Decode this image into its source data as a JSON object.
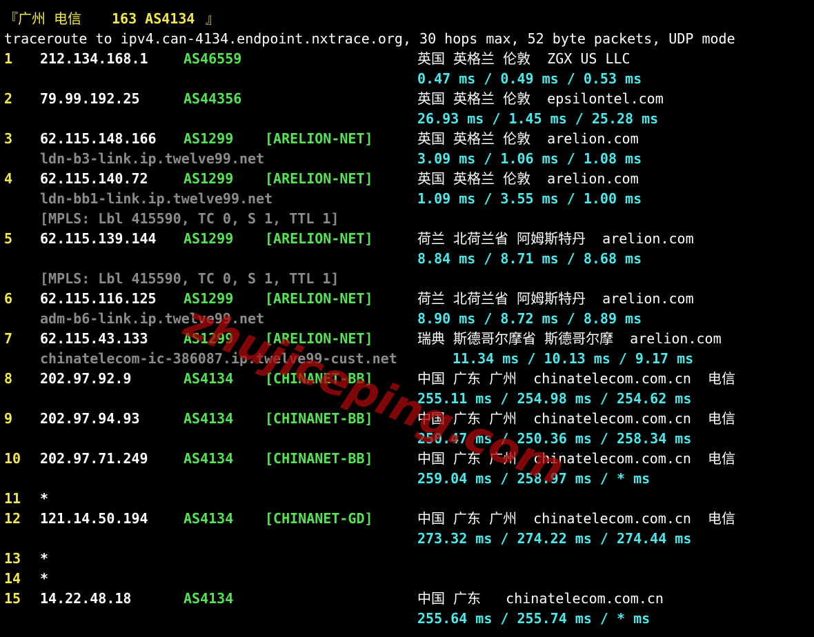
{
  "header": {
    "title_open": "『广州 电信 ",
    "title_bold": "163 AS4134",
    "title_close": " 』",
    "traceroute_line": "traceroute to ipv4.can-4134.endpoint.nxtrace.org, 30 hops max, 52 byte packets, UDP mode"
  },
  "hops": [
    {
      "num": "1",
      "ip": "212.134.168.1",
      "asn": "AS46559",
      "net": "",
      "geo": "英国 英格兰 伦敦  ZGX US LLC",
      "rtt": "0.47 ms / 0.49 ms / 0.53 ms",
      "host": "",
      "mpls": ""
    },
    {
      "num": "2",
      "ip": "79.99.192.25",
      "asn": "AS44356",
      "net": "",
      "geo": "英国 英格兰 伦敦  epsilontel.com",
      "rtt": "26.93 ms / 1.45 ms / 25.28 ms",
      "host": "",
      "mpls": ""
    },
    {
      "num": "3",
      "ip": "62.115.148.166",
      "asn": "AS1299",
      "net": "[ARELION-NET]",
      "geo": "英国 英格兰 伦敦  arelion.com",
      "rtt": "3.09 ms / 1.06 ms / 1.08 ms",
      "host": "ldn-b3-link.ip.twelve99.net",
      "mpls": ""
    },
    {
      "num": "4",
      "ip": "62.115.140.72",
      "asn": "AS1299",
      "net": "[ARELION-NET]",
      "geo": "英国 英格兰 伦敦  arelion.com",
      "rtt": "1.09 ms / 3.55 ms / 1.00 ms",
      "host": "ldn-bb1-link.ip.twelve99.net",
      "mpls": "[MPLS: Lbl 415590, TC 0, S 1, TTL 1]"
    },
    {
      "num": "5",
      "ip": "62.115.139.144",
      "asn": "AS1299",
      "net": "[ARELION-NET]",
      "geo": "荷兰 北荷兰省 阿姆斯特丹  arelion.com",
      "rtt": "8.84 ms / 8.71 ms / 8.68 ms",
      "host": "",
      "mpls": "[MPLS: Lbl 415590, TC 0, S 1, TTL 1]"
    },
    {
      "num": "6",
      "ip": "62.115.116.125",
      "asn": "AS1299",
      "net": "[ARELION-NET]",
      "geo": "荷兰 北荷兰省 阿姆斯特丹  arelion.com",
      "rtt": "8.90 ms / 8.72 ms / 8.89 ms",
      "host": "adm-b6-link.ip.twelve99.net",
      "mpls": ""
    },
    {
      "num": "7",
      "ip": "62.115.43.133",
      "asn": "AS1299",
      "net": "[ARELION-NET]",
      "geo": "瑞典 斯德哥尔摩省 斯德哥尔摩  arelion.com",
      "rtt": "11.34 ms / 10.13 ms / 9.17 ms",
      "host": "chinatelecom-ic-386087.ip.twelve99-cust.net",
      "mpls": ""
    },
    {
      "num": "8",
      "ip": "202.97.92.9",
      "asn": "AS4134",
      "net": "[CHINANET-BB]",
      "geo": "中国 广东 广州  chinatelecom.com.cn  电信",
      "rtt": "255.11 ms / 254.98 ms / 254.62 ms",
      "host": "",
      "mpls": ""
    },
    {
      "num": "9",
      "ip": "202.97.94.93",
      "asn": "AS4134",
      "net": "[CHINANET-BB]",
      "geo": "中国 广东 广州  chinatelecom.com.cn  电信",
      "rtt": "250.47 ms / 250.36 ms / 258.34 ms",
      "host": "",
      "mpls": ""
    },
    {
      "num": "10",
      "ip": "202.97.71.249",
      "asn": "AS4134",
      "net": "[CHINANET-BB]",
      "geo": "中国 广东 广州  chinatelecom.com.cn  电信",
      "rtt": "259.04 ms / 258.97 ms / * ms",
      "host": "",
      "mpls": ""
    },
    {
      "num": "11",
      "ip": "*",
      "asn": "",
      "net": "",
      "geo": "",
      "rtt": "",
      "host": "",
      "mpls": ""
    },
    {
      "num": "12",
      "ip": "121.14.50.194",
      "asn": "AS4134",
      "net": "[CHINANET-GD]",
      "geo": "中国 广东 广州  chinatelecom.com.cn  电信",
      "rtt": "273.32 ms / 274.22 ms / 274.44 ms",
      "host": "",
      "mpls": ""
    },
    {
      "num": "13",
      "ip": "*",
      "asn": "",
      "net": "",
      "geo": "",
      "rtt": "",
      "host": "",
      "mpls": ""
    },
    {
      "num": "14",
      "ip": "*",
      "asn": "",
      "net": "",
      "geo": "",
      "rtt": "",
      "host": "",
      "mpls": ""
    },
    {
      "num": "15",
      "ip": "14.22.48.18",
      "asn": "AS4134",
      "net": "",
      "geo": "中国 广东   chinatelecom.com.cn",
      "rtt": "255.64 ms / 255.74 ms / * ms",
      "host": "",
      "mpls": ""
    }
  ],
  "watermark": "zhujiceping.com",
  "colors": {
    "background": "#000000",
    "hop_number": "#f2ea4d",
    "ip": "#ffffff",
    "asn": "#55e255",
    "rtt": "#4de8ea",
    "hostname": "#8b8b8b",
    "watermark": "#aa0a0a"
  }
}
